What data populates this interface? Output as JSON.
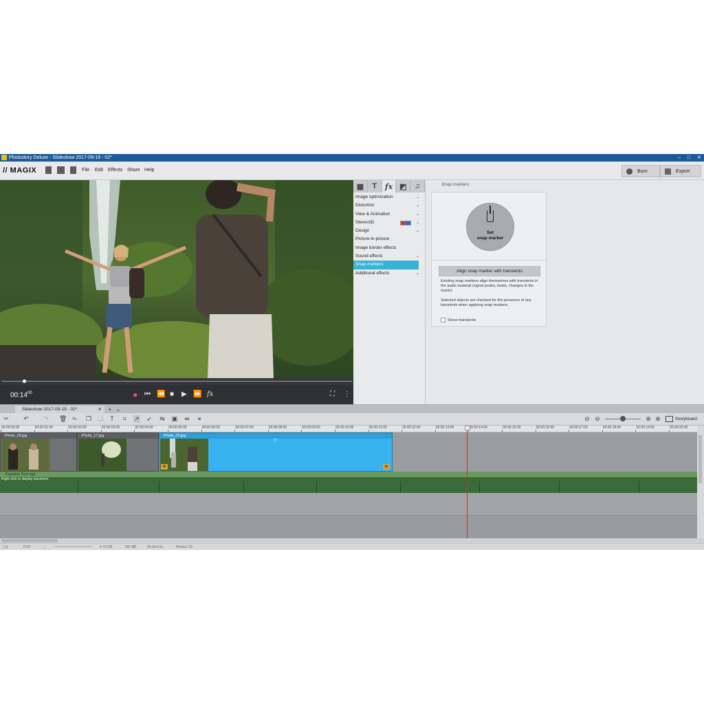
{
  "window": {
    "title": "Photostory Deluxe - Slideshow 2017-09-19 - 02*",
    "controls": [
      "–",
      "□",
      "✕"
    ]
  },
  "menubar": {
    "logo": "// MAGIX",
    "menus": [
      "File",
      "Edit",
      "Effects",
      "Share",
      "Help"
    ],
    "burn_label": "Burn",
    "export_label": "Export"
  },
  "preview": {
    "time": "00:14",
    "time_frames": "00"
  },
  "effects": {
    "tabs": [
      "▦",
      "T",
      "fx",
      "◩",
      "♫"
    ],
    "items": [
      {
        "label": "Image optimization",
        "chevron": "⌄"
      },
      {
        "label": "Distortion",
        "chevron": "⌄"
      },
      {
        "label": "View & Animation",
        "chevron": "⌄"
      },
      {
        "label": "Stereo3D",
        "chevron": "⌄"
      },
      {
        "label": "Design",
        "chevron": "⌄"
      },
      {
        "label": "Picture-in-picture",
        "chevron": ""
      },
      {
        "label": "Image border effects",
        "chevron": ""
      },
      {
        "label": "Sound effects",
        "chevron": "⌄"
      },
      {
        "label": "Snap markers",
        "chevron": ""
      },
      {
        "label": "Additional effects",
        "chevron": "⌄"
      }
    ],
    "selected": "Snap markers"
  },
  "snap": {
    "title": "Snap markers",
    "button_line1": "Set",
    "button_line2": "snap marker",
    "align_button": "Align snap marker with transients",
    "desc1": "Existing snap markers align themselves with transients in the audio material (signal peaks, beats, changes in the music).",
    "desc2": "Selected objects are checked for the presence of any transients when applying snap markers.",
    "show_transients": "Show transients"
  },
  "project": {
    "tab_label": "Slideshow 2017-09-19 - 02*",
    "tab_close": "✕",
    "add": "+",
    "dropdown": "⌄"
  },
  "toolbar": {
    "storyboard_label": "Storyboard"
  },
  "ruler": {
    "ticks": [
      "00:00:00:00",
      "00:00:01:00",
      "00:00:02:00",
      "00:00:03:00",
      "00:00:04:00",
      "00:00:05:00",
      "00:00:06:00",
      "00:00:07:00",
      "00:00:08:00",
      "00:00:09:00",
      "00:00:10:00",
      "00:00:11:00",
      "00:00:12:00",
      "00:00:13:00",
      "00:00:14:00",
      "00:00:15:00",
      "00:00:16:00",
      "00:00:17:00",
      "00:00:18:00",
      "00:00:19:00",
      "00:00:20:00"
    ]
  },
  "timeline": {
    "clips": [
      {
        "label": "Photo_18.jpg"
      },
      {
        "label": "Photo_17.jpg"
      },
      {
        "label": "Photo_15.jpg"
      }
    ],
    "audio_track": "Egyptian Sun.ogg",
    "audio_sub": "Right click to display waveform"
  },
  "status": {
    "format": "DVD",
    "capacity": "4.70 GB",
    "used": "195 MB",
    "duration": "0h:3m:51s",
    "photos": "Photos: 33"
  },
  "colors": {
    "accent": "#38b3d6",
    "selected_clip": "#39b2f0",
    "playhead": "#d42a2a",
    "titlebar": "#1b5b9a"
  }
}
